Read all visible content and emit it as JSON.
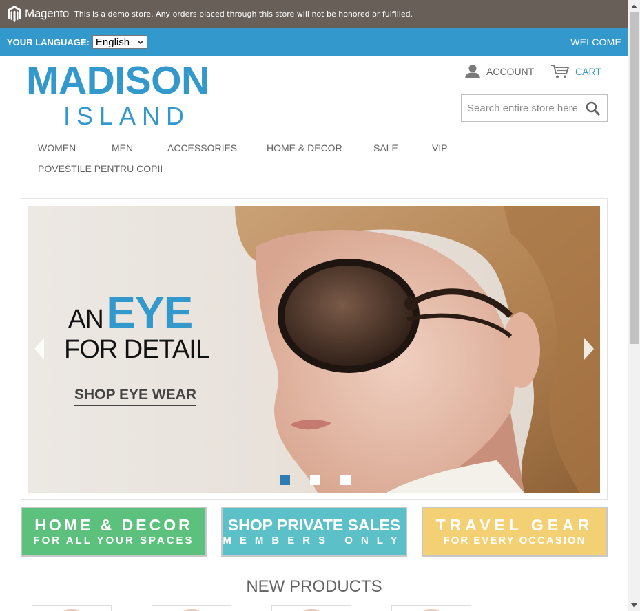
{
  "demo_notice": {
    "brand": "Magento",
    "text": "This is a demo store. Any orders placed through this store will not be honored or fulfilled."
  },
  "language_bar": {
    "label": "YOUR LANGUAGE:",
    "selected": "English",
    "welcome": "WELCOME"
  },
  "header": {
    "logo_main": "MADISON",
    "logo_sub": "ISLAND",
    "account_label": "ACCOUNT",
    "cart_label": "CART",
    "search_placeholder": "Search entire store here..."
  },
  "nav": {
    "items": [
      "WOMEN",
      "MEN",
      "ACCESSORIES",
      "HOME & DECOR",
      "SALE",
      "VIP",
      "POVESTILE PENTRU COPII"
    ]
  },
  "slider": {
    "line1_a": "AN",
    "line1_b": "EYE",
    "line2": "FOR DETAIL",
    "cta": "SHOP EYE WEAR",
    "active_slide": 1,
    "slide_count": 3
  },
  "promos": [
    {
      "line1": "HOME & DECOR",
      "line2": "FOR ALL YOUR SPACES",
      "color": "#5bc17c"
    },
    {
      "line1": "SHOP PRIVATE SALES",
      "line2": "MEMBERS ONLY",
      "color": "#5cc0c8"
    },
    {
      "line1": "TRAVEL GEAR",
      "line2": "FOR EVERY OCCASION",
      "color": "#f3d074"
    }
  ],
  "new_products": {
    "heading": "NEW PRODUCTS"
  },
  "colors": {
    "accent": "#3399cc",
    "demo_bar": "#686058",
    "nav_text": "#636363"
  }
}
